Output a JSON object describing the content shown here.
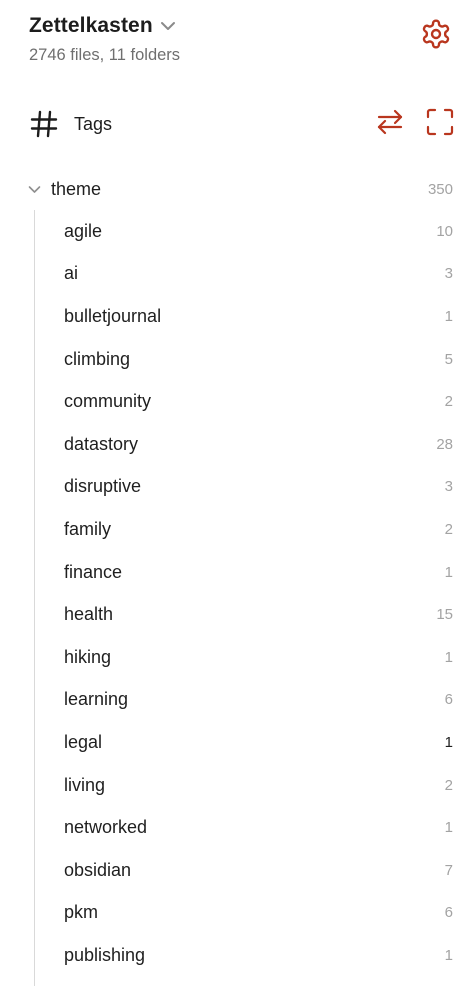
{
  "vault": {
    "name": "Zettelkasten",
    "meta": "2746 files, 11 folders"
  },
  "icons": {
    "settings": "gear-icon",
    "vault_switch": "chevron-down-icon",
    "tags": "hash-icon",
    "swap": "swap-arrows-icon",
    "expand": "fullscreen-icon",
    "collapse": "chevron-down-icon"
  },
  "colors": {
    "accent": "#b9361e",
    "text": "#1f1f1f",
    "muted": "#a3a3a3"
  },
  "panel": {
    "title": "Tags"
  },
  "tree": {
    "root": {
      "label": "theme",
      "count": "350"
    },
    "children": [
      {
        "label": "agile",
        "count": "10"
      },
      {
        "label": "ai",
        "count": "3"
      },
      {
        "label": "bulletjournal",
        "count": "1"
      },
      {
        "label": "climbing",
        "count": "5"
      },
      {
        "label": "community",
        "count": "2"
      },
      {
        "label": "datastory",
        "count": "28"
      },
      {
        "label": "disruptive",
        "count": "3"
      },
      {
        "label": "family",
        "count": "2"
      },
      {
        "label": "finance",
        "count": "1"
      },
      {
        "label": "health",
        "count": "15"
      },
      {
        "label": "hiking",
        "count": "1"
      },
      {
        "label": "learning",
        "count": "6"
      },
      {
        "label": "legal",
        "count": "1"
      },
      {
        "label": "living",
        "count": "2"
      },
      {
        "label": "networked",
        "count": "1"
      },
      {
        "label": "obsidian",
        "count": "7"
      },
      {
        "label": "pkm",
        "count": "6"
      },
      {
        "label": "publishing",
        "count": "1"
      }
    ]
  }
}
